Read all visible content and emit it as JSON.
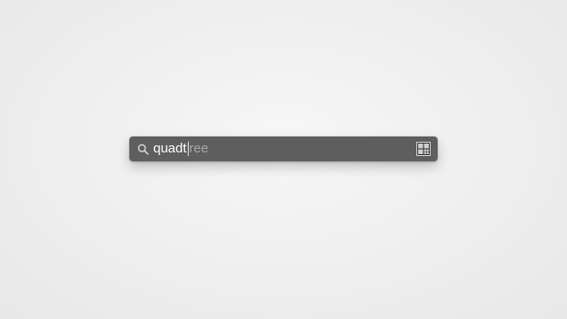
{
  "spotlight": {
    "query_typed": "quadt",
    "query_suggestion": "ree",
    "icons": {
      "search": "search-icon",
      "result_app": "grid-app-icon"
    },
    "colors": {
      "bar_background": "#5f5e5f",
      "typed_text": "#ffffff",
      "suggestion_text": "#a9a8a9"
    }
  }
}
